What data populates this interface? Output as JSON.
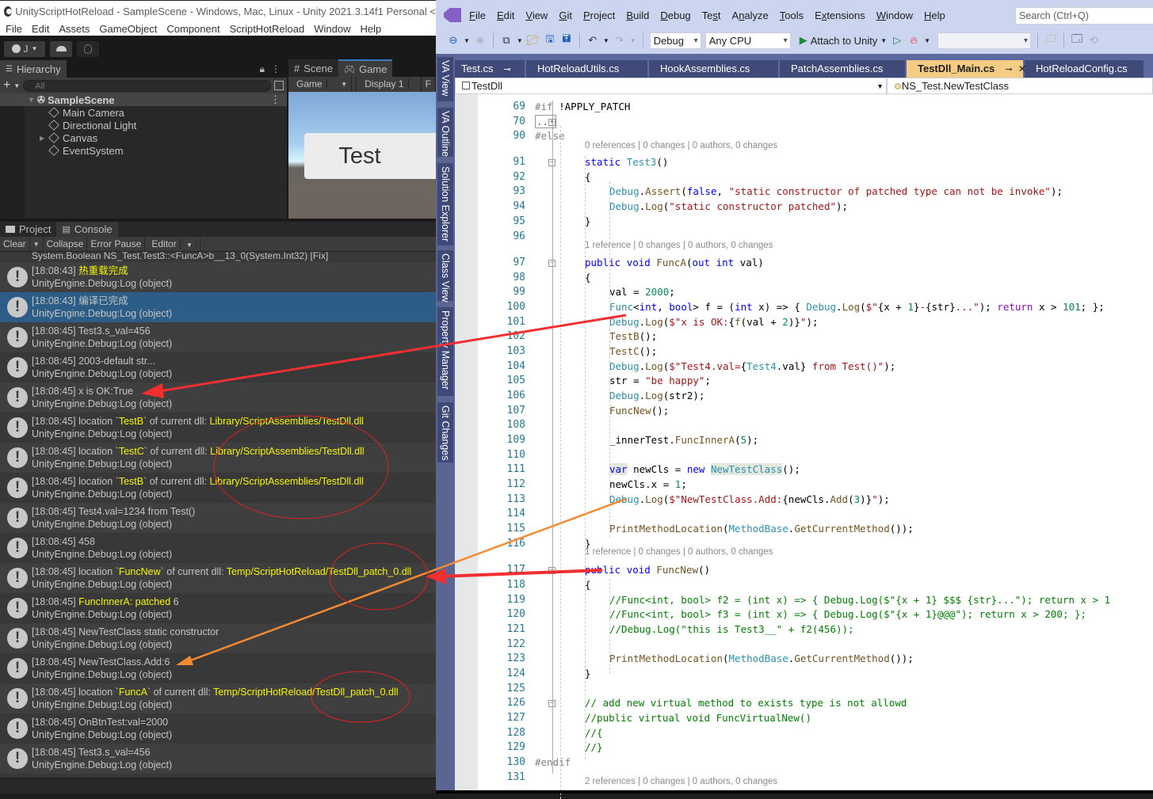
{
  "unity": {
    "window_title": "UnityScriptHotReload - SampleScene - Windows, Mac, Linux - Unity 2021.3.14f1 Personal <",
    "menu": [
      "File",
      "Edit",
      "Assets",
      "GameObject",
      "Component",
      "ScriptHotReload",
      "Window",
      "Help"
    ],
    "toolbar": {
      "account_label": "J",
      "account_icon": "account-icon",
      "cloud_icon": "cloud-icon",
      "collab_icon": "collab-icon"
    },
    "hierarchy": {
      "tab_label": "Hierarchy",
      "search_placeholder": "All",
      "scene": "SampleScene",
      "items": [
        {
          "label": "Main Camera",
          "expandable": false
        },
        {
          "label": "Directional Light",
          "expandable": false
        },
        {
          "label": "Canvas",
          "expandable": true
        },
        {
          "label": "EventSystem",
          "expandable": false
        }
      ]
    },
    "scene_tab": "Scene",
    "game_tab": "Game",
    "game_toolbar": {
      "view": "Game",
      "display": "Display 1",
      "extra": "F"
    },
    "game_button_label": "Test",
    "project_tab": "Project",
    "console_tab": "Console",
    "console_toolbar": {
      "clear": "Clear",
      "collapse": "Collapse",
      "error_pause": "Error Pause",
      "editor": "Editor"
    },
    "console_partial": "System.Boolean NS_Test.Test3::<FuncA>b__13_0(System.Int32) [Fix]",
    "console_entries": [
      {
        "time": "[18:08:43]",
        "parts": [
          {
            "t": " "
          },
          {
            "t": "热重载完成",
            "hl": true
          }
        ],
        "trace": "UnityEngine.Debug:Log (object)"
      },
      {
        "time": "[18:08:43]",
        "parts": [
          {
            "t": " 编译已完成"
          }
        ],
        "trace": "UnityEngine.Debug:Log (object)",
        "selected": true
      },
      {
        "time": "[18:08:45]",
        "parts": [
          {
            "t": " Test3.s_val=456"
          }
        ],
        "trace": "UnityEngine.Debug:Log (object)"
      },
      {
        "time": "[18:08:45]",
        "parts": [
          {
            "t": " 2003-default str..."
          }
        ],
        "trace": "UnityEngine.Debug:Log (object)"
      },
      {
        "time": "[18:08:45]",
        "parts": [
          {
            "t": " x is OK:True"
          }
        ],
        "trace": "UnityEngine.Debug:Log (object)"
      },
      {
        "time": "[18:08:45]",
        "parts": [
          {
            "t": " location `"
          },
          {
            "t": "TestB",
            "hl": true
          },
          {
            "t": "` of current dll: "
          },
          {
            "t": "Library/ScriptAssemblies/TestDll.dll",
            "hl": true
          }
        ],
        "trace": "UnityEngine.Debug:Log (object)"
      },
      {
        "time": "[18:08:45]",
        "parts": [
          {
            "t": " location `"
          },
          {
            "t": "TestC",
            "hl": true
          },
          {
            "t": "` of current dll: "
          },
          {
            "t": "Library/ScriptAssemblies/TestDll.dll",
            "hl": true
          }
        ],
        "trace": "UnityEngine.Debug:Log (object)"
      },
      {
        "time": "[18:08:45]",
        "parts": [
          {
            "t": " location `"
          },
          {
            "t": "TestB",
            "hl": true
          },
          {
            "t": "` of current dll: "
          },
          {
            "t": "Library/ScriptAssemblies/TestDll.dll",
            "hl": true
          }
        ],
        "trace": "UnityEngine.Debug:Log (object)"
      },
      {
        "time": "[18:08:45]",
        "parts": [
          {
            "t": " Test4.val=1234 from Test()"
          }
        ],
        "trace": "UnityEngine.Debug:Log (object)"
      },
      {
        "time": "[18:08:45]",
        "parts": [
          {
            "t": " 458"
          }
        ],
        "trace": "UnityEngine.Debug:Log (object)"
      },
      {
        "time": "[18:08:45]",
        "parts": [
          {
            "t": " location `"
          },
          {
            "t": "FuncNew",
            "hl": true
          },
          {
            "t": "` of current dll: "
          },
          {
            "t": "Temp/ScriptHotReload/TestDll_patch_0.dll",
            "hl": true
          }
        ],
        "trace": "UnityEngine.Debug:Log (object)"
      },
      {
        "time": "[18:08:45]",
        "parts": [
          {
            "t": " "
          },
          {
            "t": "FuncInnerA: patched",
            "hl": true
          },
          {
            "t": " 6"
          }
        ],
        "trace": "UnityEngine.Debug:Log (object)"
      },
      {
        "time": "[18:08:45]",
        "parts": [
          {
            "t": " NewTestClass static constructor"
          }
        ],
        "trace": "UnityEngine.Debug:Log (object)"
      },
      {
        "time": "[18:08:45]",
        "parts": [
          {
            "t": " NewTestClass.Add:6"
          }
        ],
        "trace": "UnityEngine.Debug:Log (object)"
      },
      {
        "time": "[18:08:45]",
        "parts": [
          {
            "t": " location `"
          },
          {
            "t": "FuncA",
            "hl": true
          },
          {
            "t": "` of current dll: "
          },
          {
            "t": "Temp/ScriptHotReload/TestDll_patch_0.dll",
            "hl": true
          }
        ],
        "trace": "UnityEngine.Debug:Log (object)"
      },
      {
        "time": "[18:08:45]",
        "parts": [
          {
            "t": " OnBtnTest:val=2000"
          }
        ],
        "trace": "UnityEngine.Debug:Log (object)"
      },
      {
        "time": "[18:08:45]",
        "parts": [
          {
            "t": " Test3.s_val=456"
          }
        ],
        "trace": "UnityEngine.Debug:Log (object)"
      }
    ]
  },
  "vs": {
    "menu": [
      {
        "label": "File",
        "u": 0
      },
      {
        "label": "Edit",
        "u": 0
      },
      {
        "label": "View",
        "u": 0
      },
      {
        "label": "Git",
        "u": 0
      },
      {
        "label": "Project",
        "u": 0
      },
      {
        "label": "Build",
        "u": 0
      },
      {
        "label": "Debug",
        "u": 0
      },
      {
        "label": "Test",
        "u": 2
      },
      {
        "label": "Analyze",
        "u": 1
      },
      {
        "label": "Tools",
        "u": 0
      },
      {
        "label": "Extensions",
        "u": 1
      },
      {
        "label": "Window",
        "u": 0
      },
      {
        "label": "Help",
        "u": 0
      }
    ],
    "search_placeholder": "Search (Ctrl+Q)",
    "toolbar": {
      "config": "Debug",
      "platform": "Any CPU",
      "attach": "Attach to Unity"
    },
    "side_tabs": [
      "VA View",
      "VA Outline",
      "Solution Explorer",
      "Class View",
      "Property Manager",
      "Git Changes"
    ],
    "tabs": [
      {
        "label": "Test.cs",
        "pinned": true
      },
      {
        "label": "HotReloadUtils.cs"
      },
      {
        "label": "HookAssemblies.cs"
      },
      {
        "label": "PatchAssemblies.cs"
      },
      {
        "label": "TestDll_Main.cs",
        "active": true,
        "pinned": true
      },
      {
        "label": "HotReloadConfig.cs"
      }
    ],
    "nav": {
      "project": "TestDll",
      "type": "NS_Test.NewTestClass"
    },
    "lens": {
      "test3": "0 references | 0 changes | 0 authors, 0 changes",
      "funcA": "1 reference | 0 changes | 0 authors, 0 changes",
      "funcNew": "1 reference | 0 changes | 0 authors, 0 changes",
      "bottom": "2 references | 0 changes | 0 authors, 0 changes"
    },
    "code_lines": [
      {
        "n": "69",
        "html": "<span class='pp'>#if</span> !APPLY_PATCH",
        "indent": 0
      },
      {
        "n": "70",
        "html": "<span style='border:1px solid #999;color:#666;padding:0 1px'>...</span>",
        "indent": 0
      },
      {
        "n": "90",
        "html": "<span class='pp'>#else</span>",
        "indent": 0
      },
      {
        "n": "91",
        "html": "<span class='kw'>static</span> <span class='ty'>Test3</span>()",
        "indent": 1
      },
      {
        "n": "92",
        "html": "{",
        "indent": 1
      },
      {
        "n": "93",
        "html": "<span class='ty'>Debug</span>.<span class='mt'>Assert</span>(<span class='kw'>false</span>, <span class='st'>\"static constructor of patched type can not be invoke\"</span>);",
        "indent": 2
      },
      {
        "n": "94",
        "html": "<span class='ty'>Debug</span>.<span class='mt'>Log</span>(<span class='st'>\"static constructor patched\"</span>);",
        "indent": 2
      },
      {
        "n": "95",
        "html": "}",
        "indent": 1
      },
      {
        "n": "96",
        "html": "",
        "indent": 1
      },
      {
        "n": "97",
        "html": "<span class='kw'>public</span> <span class='kw'>void</span> <span class='mt'>FuncA</span>(<span class='kw'>out</span> <span class='kw'>int</span> val)",
        "indent": 1
      },
      {
        "n": "98",
        "html": "{",
        "indent": 1
      },
      {
        "n": "99",
        "html": "val = <span class='nm'>2000</span>;",
        "indent": 2
      },
      {
        "n": "100",
        "html": "<span class='ty'>Func</span>&lt;<span class='kw'>int</span>, <span class='kw'>bool</span>&gt; f = (<span class='kw'>int</span> x) =&gt; { <span class='ty'>Debug</span>.<span class='mt'>Log</span>(<span class='st'>$\"</span>{x + <span class='nm'>1</span>}<span class='st'>-</span>{str}<span class='st'>...\"</span>); <span class='ct'>return</span> x &gt; <span class='nm'>101</span>; };",
        "indent": 2
      },
      {
        "n": "101",
        "html": "<span class='ty'>Debug</span>.<span class='mt'>Log</span>(<span class='st'>$\"x is OK:</span>{<span class='mt'>f</span>(val + <span class='nm'>2</span>)}<span class='st'>\"</span>);",
        "indent": 2
      },
      {
        "n": "102",
        "html": "<span class='mt'>TestB</span>();",
        "indent": 2
      },
      {
        "n": "103",
        "html": "<span class='mt'>TestC</span>();",
        "indent": 2
      },
      {
        "n": "104",
        "html": "<span class='ty'>Debug</span>.<span class='mt'>Log</span>(<span class='st'>$\"Test4.val=</span>{<span class='ty'>Test4</span>.val}<span class='st'> from Test()\"</span>);",
        "indent": 2
      },
      {
        "n": "105",
        "html": "str = <span class='st'>\"be happy\"</span>;",
        "indent": 2
      },
      {
        "n": "106",
        "html": "<span class='ty'>Debug</span>.<span class='mt'>Log</span>(str2);",
        "indent": 2
      },
      {
        "n": "107",
        "html": "<span class='mt'>FuncNew</span>();",
        "indent": 2
      },
      {
        "n": "108",
        "html": "",
        "indent": 2
      },
      {
        "n": "109",
        "html": "_innerTest.<span class='mt'>FuncInnerA</span>(<span class='nm'>5</span>);",
        "indent": 2
      },
      {
        "n": "110",
        "html": "",
        "indent": 2
      },
      {
        "n": "111",
        "html": "<span class='kw' style='background:#e4e8dc'>var</span> newCls = <span class='kw'>new</span> <span class='ty' style='background:#e4e8dc'>NewTestClass</span>();",
        "indent": 2
      },
      {
        "n": "112",
        "html": "newCls.x = <span class='nm'>1</span>;",
        "indent": 2
      },
      {
        "n": "113",
        "html": "<span class='ty'>Debug</span>.<span class='mt'>Log</span>(<span class='st'>$\"NewTestClass.Add:</span>{newCls.<span class='mt'>Add</span>(<span class='nm'>3</span>)}<span class='st'>\"</span>);",
        "indent": 2
      },
      {
        "n": "114",
        "html": "",
        "indent": 2
      },
      {
        "n": "115",
        "html": "<span class='mt'>PrintMethodLocation</span>(<span class='ty'>MethodBase</span>.<span class='mt'>GetCurrentMethod</span>());",
        "indent": 2
      },
      {
        "n": "116",
        "html": "}",
        "indent": 1
      },
      {
        "n": "117",
        "html": "<span class='kw'>public</span> <span class='kw'>void</span> <span class='mt'>FuncNew</span>()",
        "indent": 1
      },
      {
        "n": "118",
        "html": "{",
        "indent": 1
      },
      {
        "n": "119",
        "html": "<span class='cm'>//Func&lt;int, bool&gt; f2 = (int x) =&gt; { Debug.Log($\"{x + 1} $$$ {str}...\"); return x &gt; 1</span>",
        "indent": 2
      },
      {
        "n": "120",
        "html": "<span class='cm'>//Func&lt;int, bool&gt; f3 = (int x) =&gt; { Debug.Log($\"{x + 1}@@@\"); return x &gt; 200; };</span>",
        "indent": 2
      },
      {
        "n": "121",
        "html": "<span class='cm'>//Debug.Log(\"this is Test3__\" + f2(456));</span>",
        "indent": 2
      },
      {
        "n": "122",
        "html": "",
        "indent": 2
      },
      {
        "n": "123",
        "html": "<span class='mt'>PrintMethodLocation</span>(<span class='ty'>MethodBase</span>.<span class='mt'>GetCurrentMethod</span>());",
        "indent": 2
      },
      {
        "n": "124",
        "html": "}",
        "indent": 1
      },
      {
        "n": "125",
        "html": "",
        "indent": 1
      },
      {
        "n": "126",
        "html": "<span class='cm'>// add new virtual method to exists type is not allowd</span>",
        "indent": 1
      },
      {
        "n": "127",
        "html": "<span class='cm'>//public virtual void FuncVirtualNew()</span>",
        "indent": 1
      },
      {
        "n": "128",
        "html": "<span class='cm'>//{</span>",
        "indent": 1
      },
      {
        "n": "129",
        "html": "<span class='cm'>//}</span>",
        "indent": 1
      },
      {
        "n": "130",
        "html": "<span class='pp'>#endif</span>",
        "indent": 0
      },
      {
        "n": "131",
        "html": "",
        "indent": 0
      }
    ]
  },
  "colors": {
    "highlight_yellow": "#f5f500",
    "vs_active_tab": "#f5cc84",
    "console_selected": "#2c5d87",
    "arrow_red": "#f03030",
    "arrow_orange": "#f58a32"
  }
}
